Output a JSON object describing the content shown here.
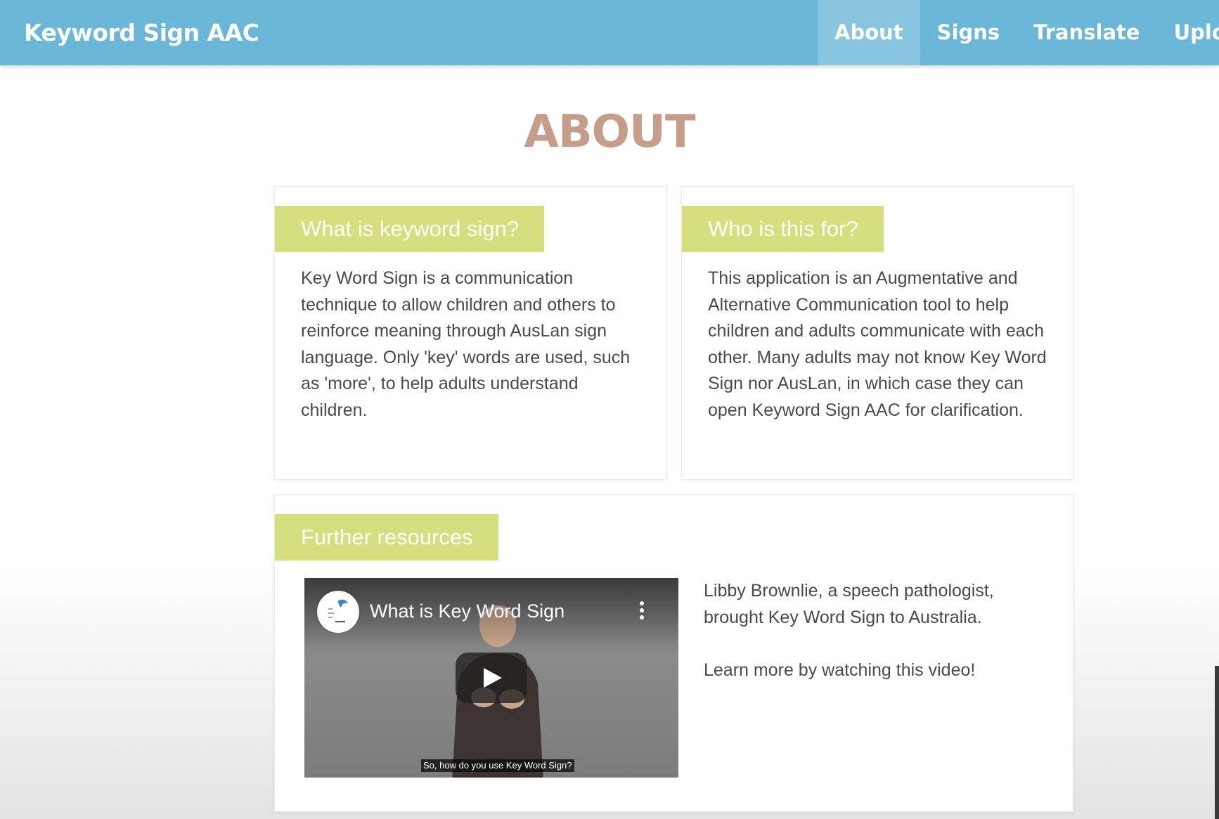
{
  "nav": {
    "brand": "Keyword Sign AAC",
    "links": [
      "About",
      "Signs",
      "Translate",
      "Uploa"
    ],
    "active": "About",
    "bg_color": "#6ab7d7"
  },
  "page": {
    "title": "ABOUT",
    "title_color": "#c59d88"
  },
  "cards": [
    {
      "heading": "What is keyword sign?",
      "body": "Key Word Sign is a communication technique to allow children and others to reinforce meaning through AusLan sign language. Only 'key' words are used, such as 'more', to help adults understand children."
    },
    {
      "heading": "Who is this for?",
      "body": "This application is an Augmentative and Alternative Communication tool to help children and adults communicate with each other. Many adults may not know Key Word Sign nor AusLan, in which case they can open Keyword Sign AAC for clarification."
    }
  ],
  "resources": {
    "heading": "Further resources",
    "video": {
      "title": "What is Key Word Sign",
      "caption": "So, how do you use Key Word Sign?",
      "icons": [
        "channel-logo",
        "more-vertical-icon",
        "play-icon"
      ]
    },
    "paragraphs": [
      "Libby Brownlie, a speech pathologist, brought Key Word Sign to Australia.",
      "Learn more by watching this video!"
    ]
  },
  "colors": {
    "accent_header": "#d6de7d"
  }
}
